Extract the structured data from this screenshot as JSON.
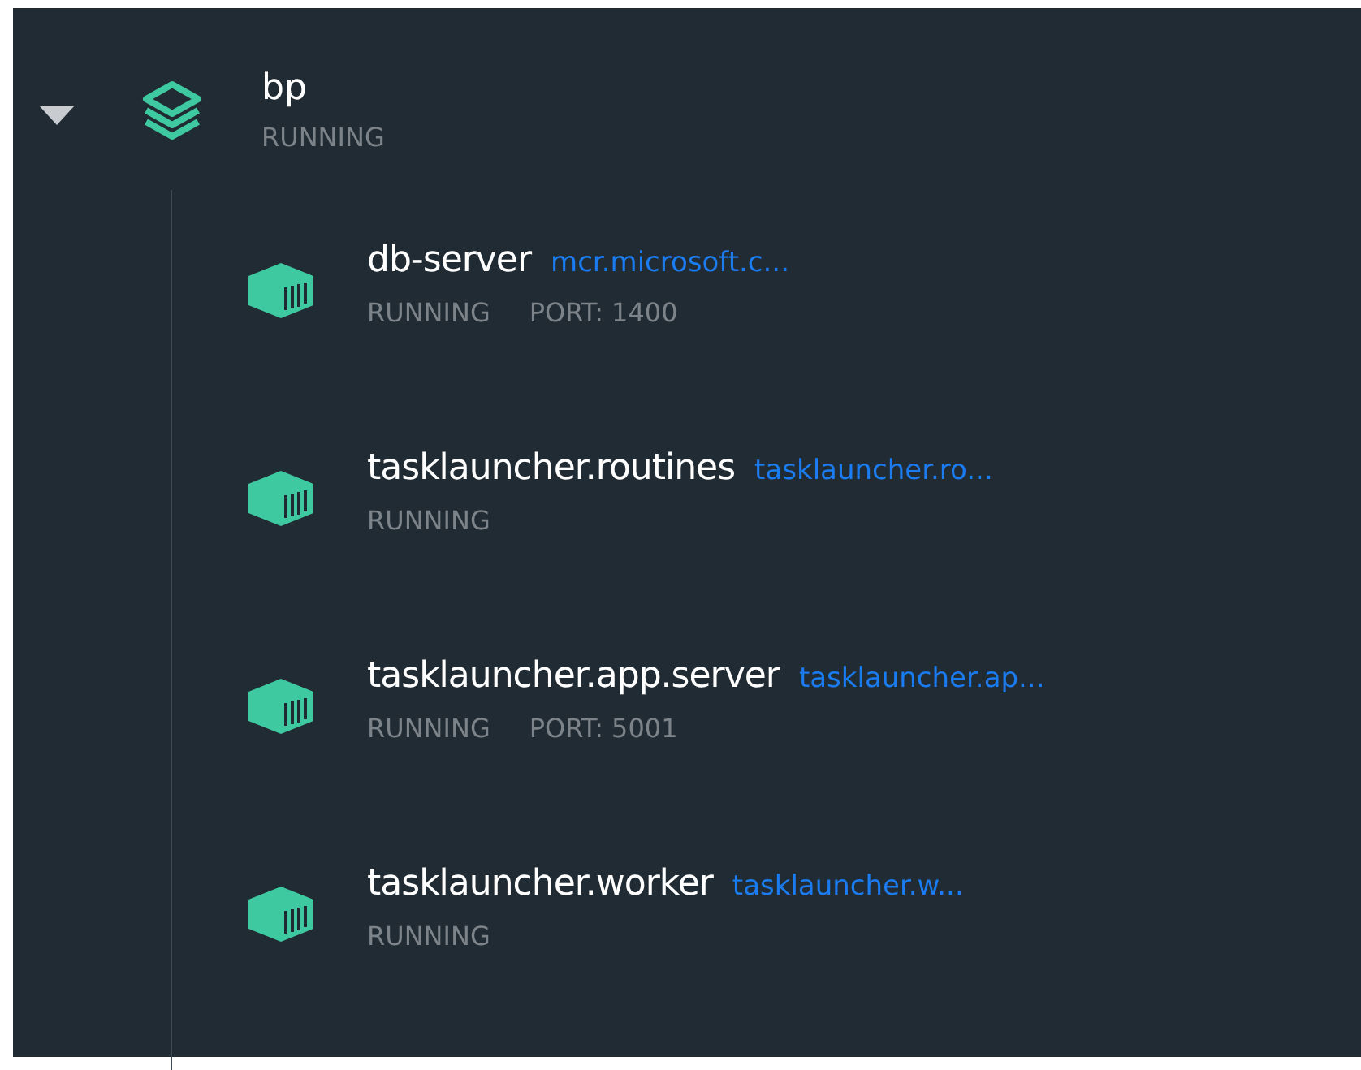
{
  "stack": {
    "name": "bp",
    "status": "RUNNING",
    "expanded": true,
    "containers": [
      {
        "name": "db-server",
        "image": "mcr.microsoft.c...",
        "status": "RUNNING",
        "port": "PORT: 1400"
      },
      {
        "name": "tasklauncher.routines",
        "image": "tasklauncher.ro...",
        "status": "RUNNING"
      },
      {
        "name": "tasklauncher.app.server",
        "image": "tasklauncher.ap...",
        "status": "RUNNING",
        "port": "PORT: 5001"
      },
      {
        "name": "tasklauncher.worker",
        "image": "tasklauncher.w...",
        "status": "RUNNING"
      }
    ]
  }
}
